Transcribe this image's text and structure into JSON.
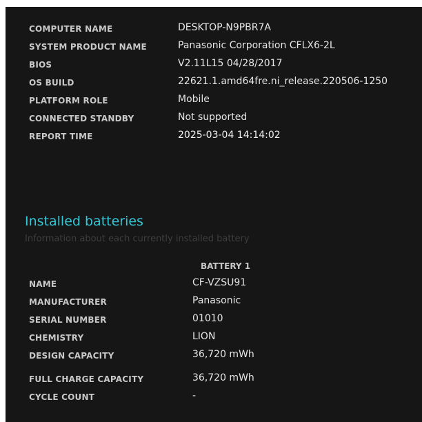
{
  "system_info": [
    {
      "label": "COMPUTER NAME",
      "value": "DESKTOP-N9PBR7A"
    },
    {
      "label": "SYSTEM PRODUCT NAME",
      "value": "Panasonic Corporation CFLX6-2L"
    },
    {
      "label": "BIOS",
      "value": "V2.11L15 04/28/2017"
    },
    {
      "label": "OS BUILD",
      "value": "22621.1.amd64fre.ni_release.220506-1250"
    },
    {
      "label": "PLATFORM ROLE",
      "value": "Mobile"
    },
    {
      "label": "CONNECTED STANDBY",
      "value": "Not supported"
    },
    {
      "label": "REPORT TIME",
      "value": "2025-03-04  14:14:02"
    }
  ],
  "installed_batteries": {
    "title": "Installed batteries",
    "subtitle": "Information about each currently installed battery",
    "column_header": "BATTERY 1",
    "rows": [
      {
        "label": "NAME",
        "value": "CF-VZSU91"
      },
      {
        "label": "MANUFACTURER",
        "value": "Panasonic"
      },
      {
        "label": "SERIAL NUMBER",
        "value": "01010"
      },
      {
        "label": "CHEMISTRY",
        "value": "LION"
      },
      {
        "label": "DESIGN CAPACITY",
        "value": "36,720 mWh"
      },
      {
        "label": "FULL CHARGE CAPACITY",
        "value": "36,720 mWh"
      },
      {
        "label": "CYCLE COUNT",
        "value": "-"
      }
    ]
  },
  "colors": {
    "background": "#161616",
    "section_title": "#33c7d6",
    "label": "#c8c8c8",
    "value": "#e6e6e6"
  }
}
